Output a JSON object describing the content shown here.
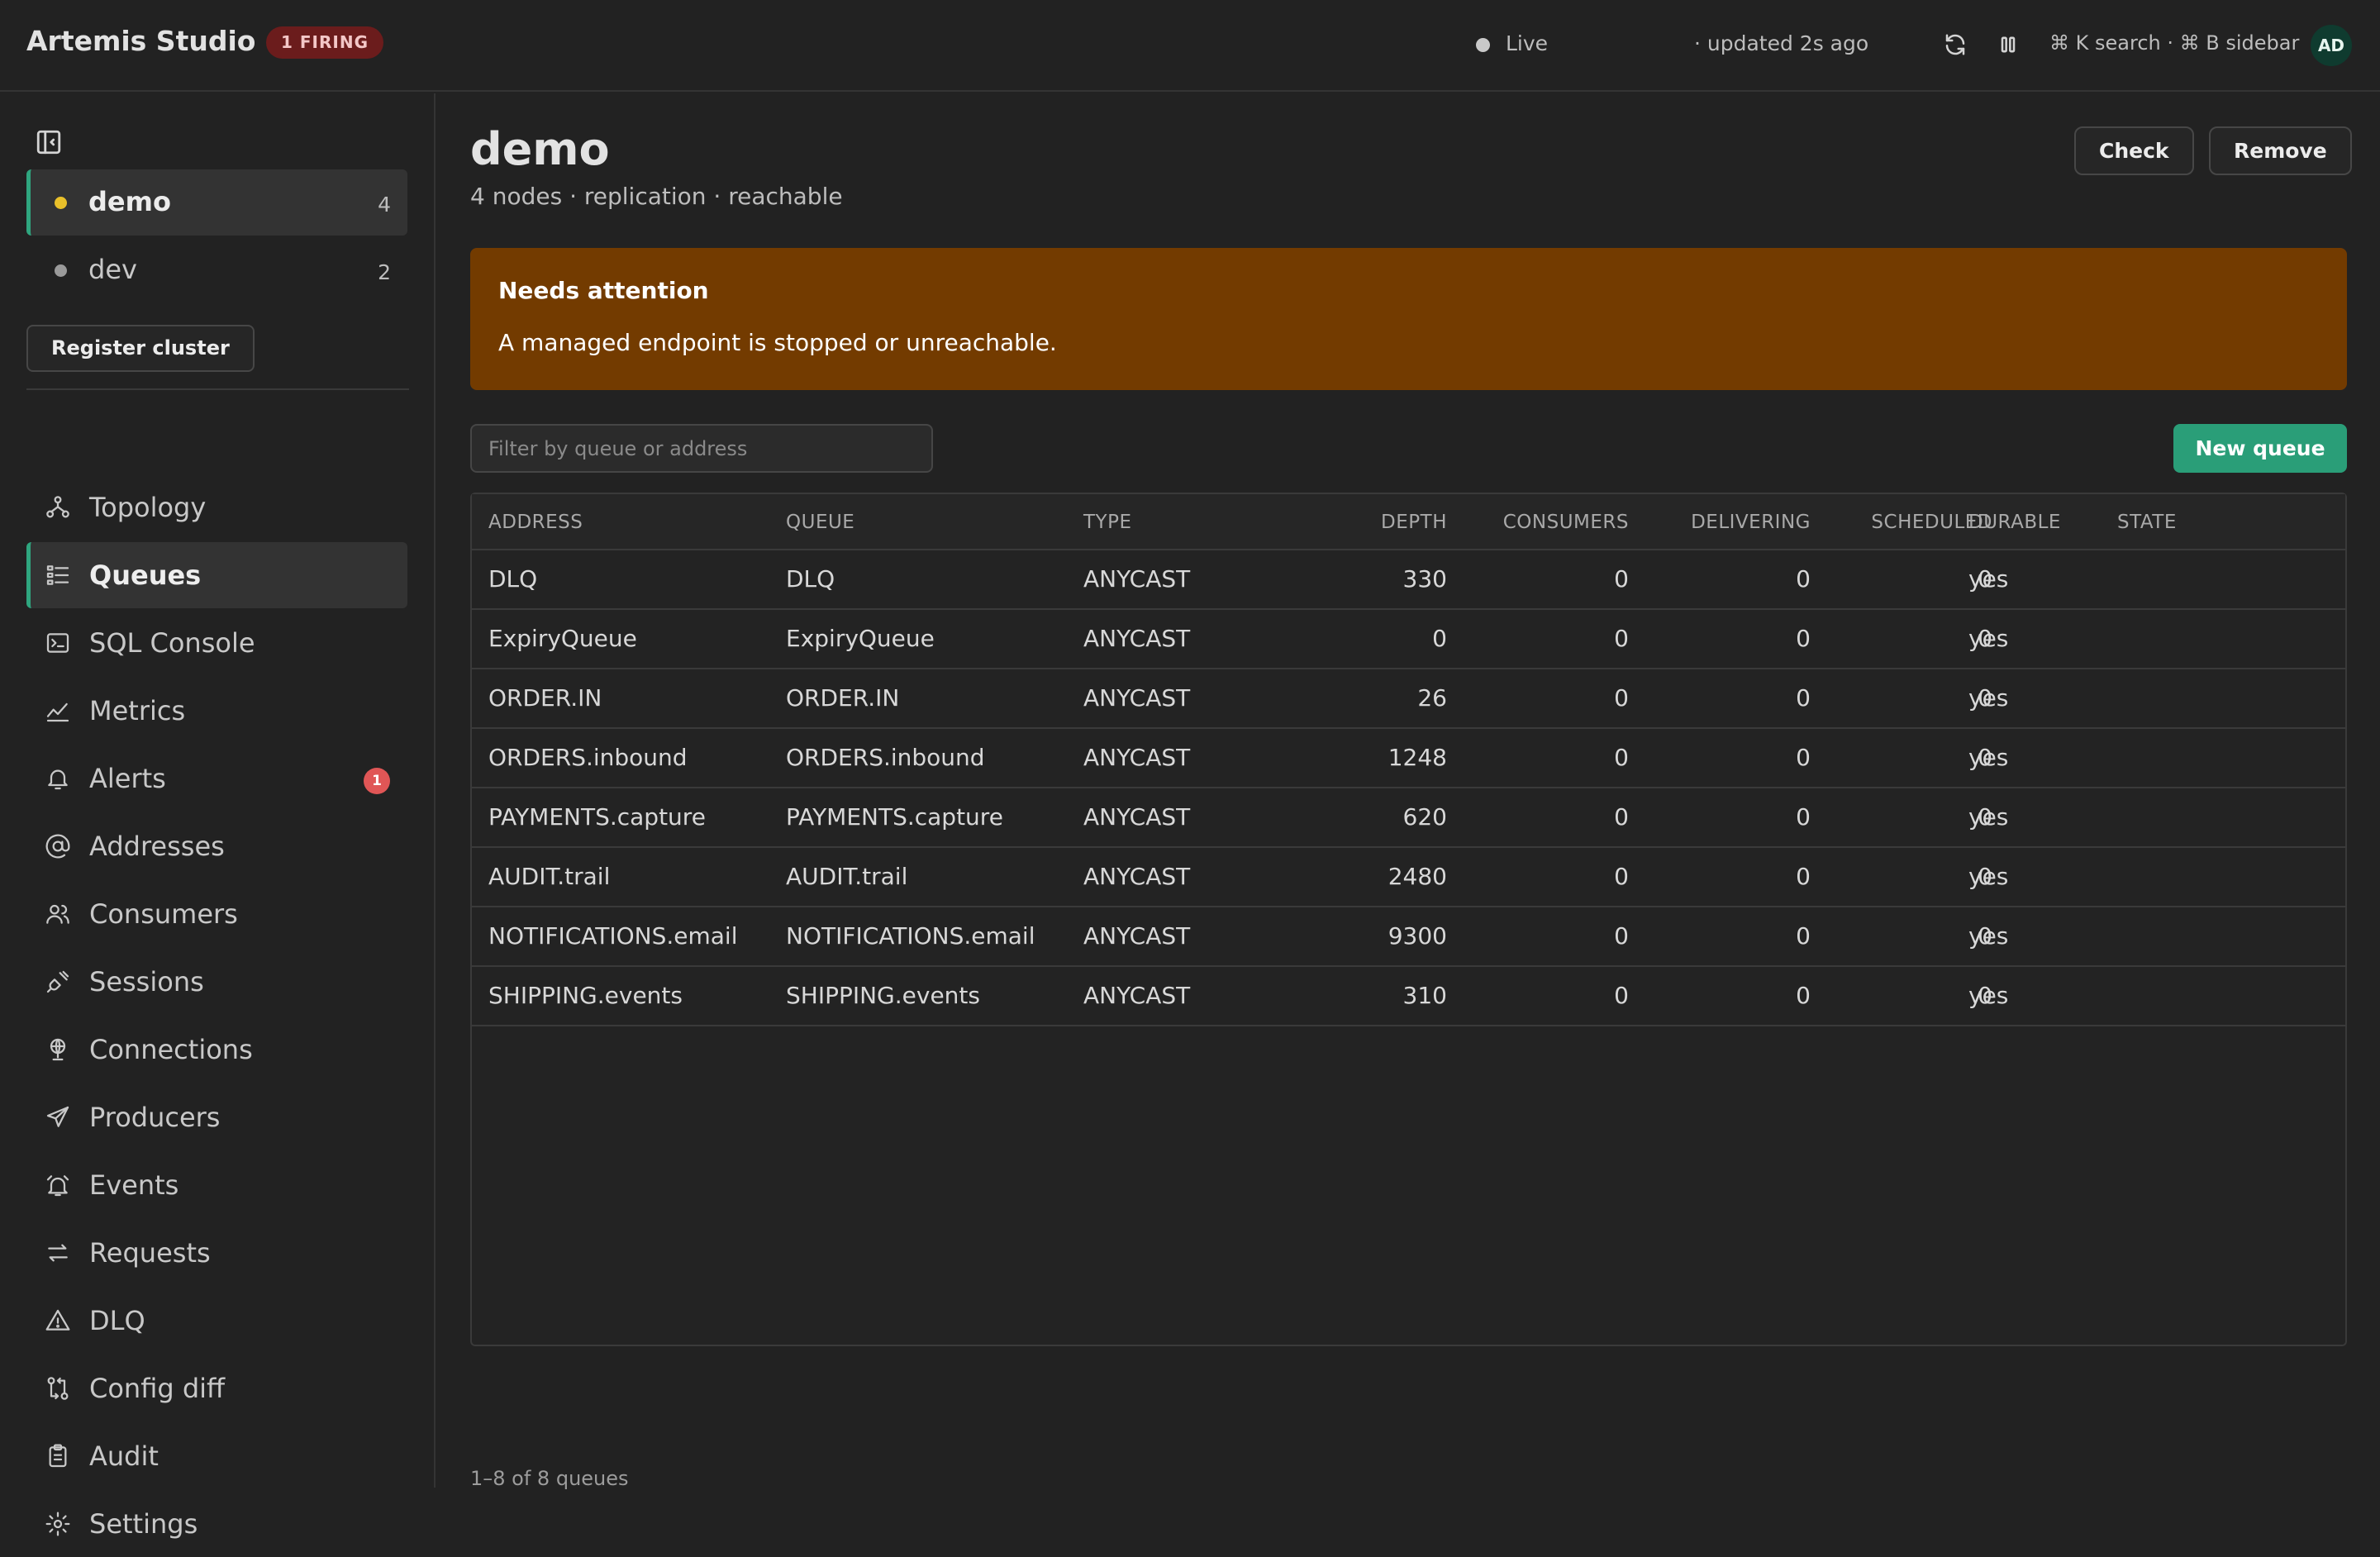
{
  "topbar": {
    "app_title": "Artemis Studio",
    "firing_badge": "1 FIRING",
    "live_label": "Live",
    "updated_label": "· updated 2s ago",
    "shortcuts_hint": "⌘ K search · ⌘ B sidebar",
    "avatar_initials": "AD"
  },
  "sidebar": {
    "clusters": [
      {
        "name": "demo",
        "count": "4",
        "dot_color": "#e9c02a",
        "active": true
      },
      {
        "name": "dev",
        "count": "2",
        "dot_color": "#9a9a9a",
        "active": false
      }
    ],
    "register_label": "Register cluster",
    "nav": [
      {
        "label": "Topology",
        "icon": "topology-icon"
      },
      {
        "label": "Queues",
        "icon": "queues-icon",
        "active": true
      },
      {
        "label": "SQL Console",
        "icon": "terminal-icon"
      },
      {
        "label": "Metrics",
        "icon": "metrics-icon"
      },
      {
        "label": "Alerts",
        "icon": "bell-icon",
        "badge": "1"
      },
      {
        "label": "Addresses",
        "icon": "at-icon"
      },
      {
        "label": "Consumers",
        "icon": "users-icon"
      },
      {
        "label": "Sessions",
        "icon": "plug-icon"
      },
      {
        "label": "Connections",
        "icon": "globe-icon"
      },
      {
        "label": "Producers",
        "icon": "send-icon"
      },
      {
        "label": "Events",
        "icon": "alarm-icon"
      },
      {
        "label": "Requests",
        "icon": "arrows-icon"
      },
      {
        "label": "DLQ",
        "icon": "warning-icon"
      },
      {
        "label": "Config diff",
        "icon": "diff-icon"
      },
      {
        "label": "Audit",
        "icon": "clipboard-icon"
      },
      {
        "label": "Settings",
        "icon": "gear-icon"
      }
    ]
  },
  "main": {
    "title": "demo",
    "subtitle": "4 nodes · replication · reachable",
    "check_label": "Check",
    "remove_label": "Remove",
    "alert_title": "Needs attention",
    "alert_message": "A managed endpoint is stopped or unreachable.",
    "filter_placeholder": "Filter by queue or address",
    "new_queue_label": "New queue",
    "columns": [
      "ADDRESS",
      "QUEUE",
      "TYPE",
      "DEPTH",
      "CONSUMERS",
      "DELIVERING",
      "SCHEDULED",
      "DURABLE",
      "STATE"
    ],
    "rows": [
      {
        "address": "DLQ",
        "queue": "DLQ",
        "type": "ANYCAST",
        "depth": "330",
        "consumers": "0",
        "delivering": "0",
        "scheduled": "0",
        "durable": "yes",
        "state": ""
      },
      {
        "address": "ExpiryQueue",
        "queue": "ExpiryQueue",
        "type": "ANYCAST",
        "depth": "0",
        "consumers": "0",
        "delivering": "0",
        "scheduled": "0",
        "durable": "yes",
        "state": ""
      },
      {
        "address": "ORDER.IN",
        "queue": "ORDER.IN",
        "type": "ANYCAST",
        "depth": "26",
        "consumers": "0",
        "delivering": "0",
        "scheduled": "0",
        "durable": "yes",
        "state": ""
      },
      {
        "address": "ORDERS.inbound",
        "queue": "ORDERS.inbound",
        "type": "ANYCAST",
        "depth": "1248",
        "consumers": "0",
        "delivering": "0",
        "scheduled": "0",
        "durable": "yes",
        "state": ""
      },
      {
        "address": "PAYMENTS.capture",
        "queue": "PAYMENTS.capture",
        "type": "ANYCAST",
        "depth": "620",
        "consumers": "0",
        "delivering": "0",
        "scheduled": "0",
        "durable": "yes",
        "state": ""
      },
      {
        "address": "AUDIT.trail",
        "queue": "AUDIT.trail",
        "type": "ANYCAST",
        "depth": "2480",
        "consumers": "0",
        "delivering": "0",
        "scheduled": "0",
        "durable": "yes",
        "state": ""
      },
      {
        "address": "NOTIFICATIONS.email",
        "queue": "NOTIFICATIONS.email",
        "type": "ANYCAST",
        "depth": "9300",
        "consumers": "0",
        "delivering": "0",
        "scheduled": "0",
        "durable": "yes",
        "state": ""
      },
      {
        "address": "SHIPPING.events",
        "queue": "SHIPPING.events",
        "type": "ANYCAST",
        "depth": "310",
        "consumers": "0",
        "delivering": "0",
        "scheduled": "0",
        "durable": "yes",
        "state": ""
      }
    ],
    "footer": "1–8 of 8 queues"
  },
  "colors": {
    "accent": "#2fa67f",
    "primary_button": "#2a9e78",
    "warning_banner": "#733b00",
    "firing_badge": "#6b1c1c",
    "alert_badge": "#e05656"
  }
}
